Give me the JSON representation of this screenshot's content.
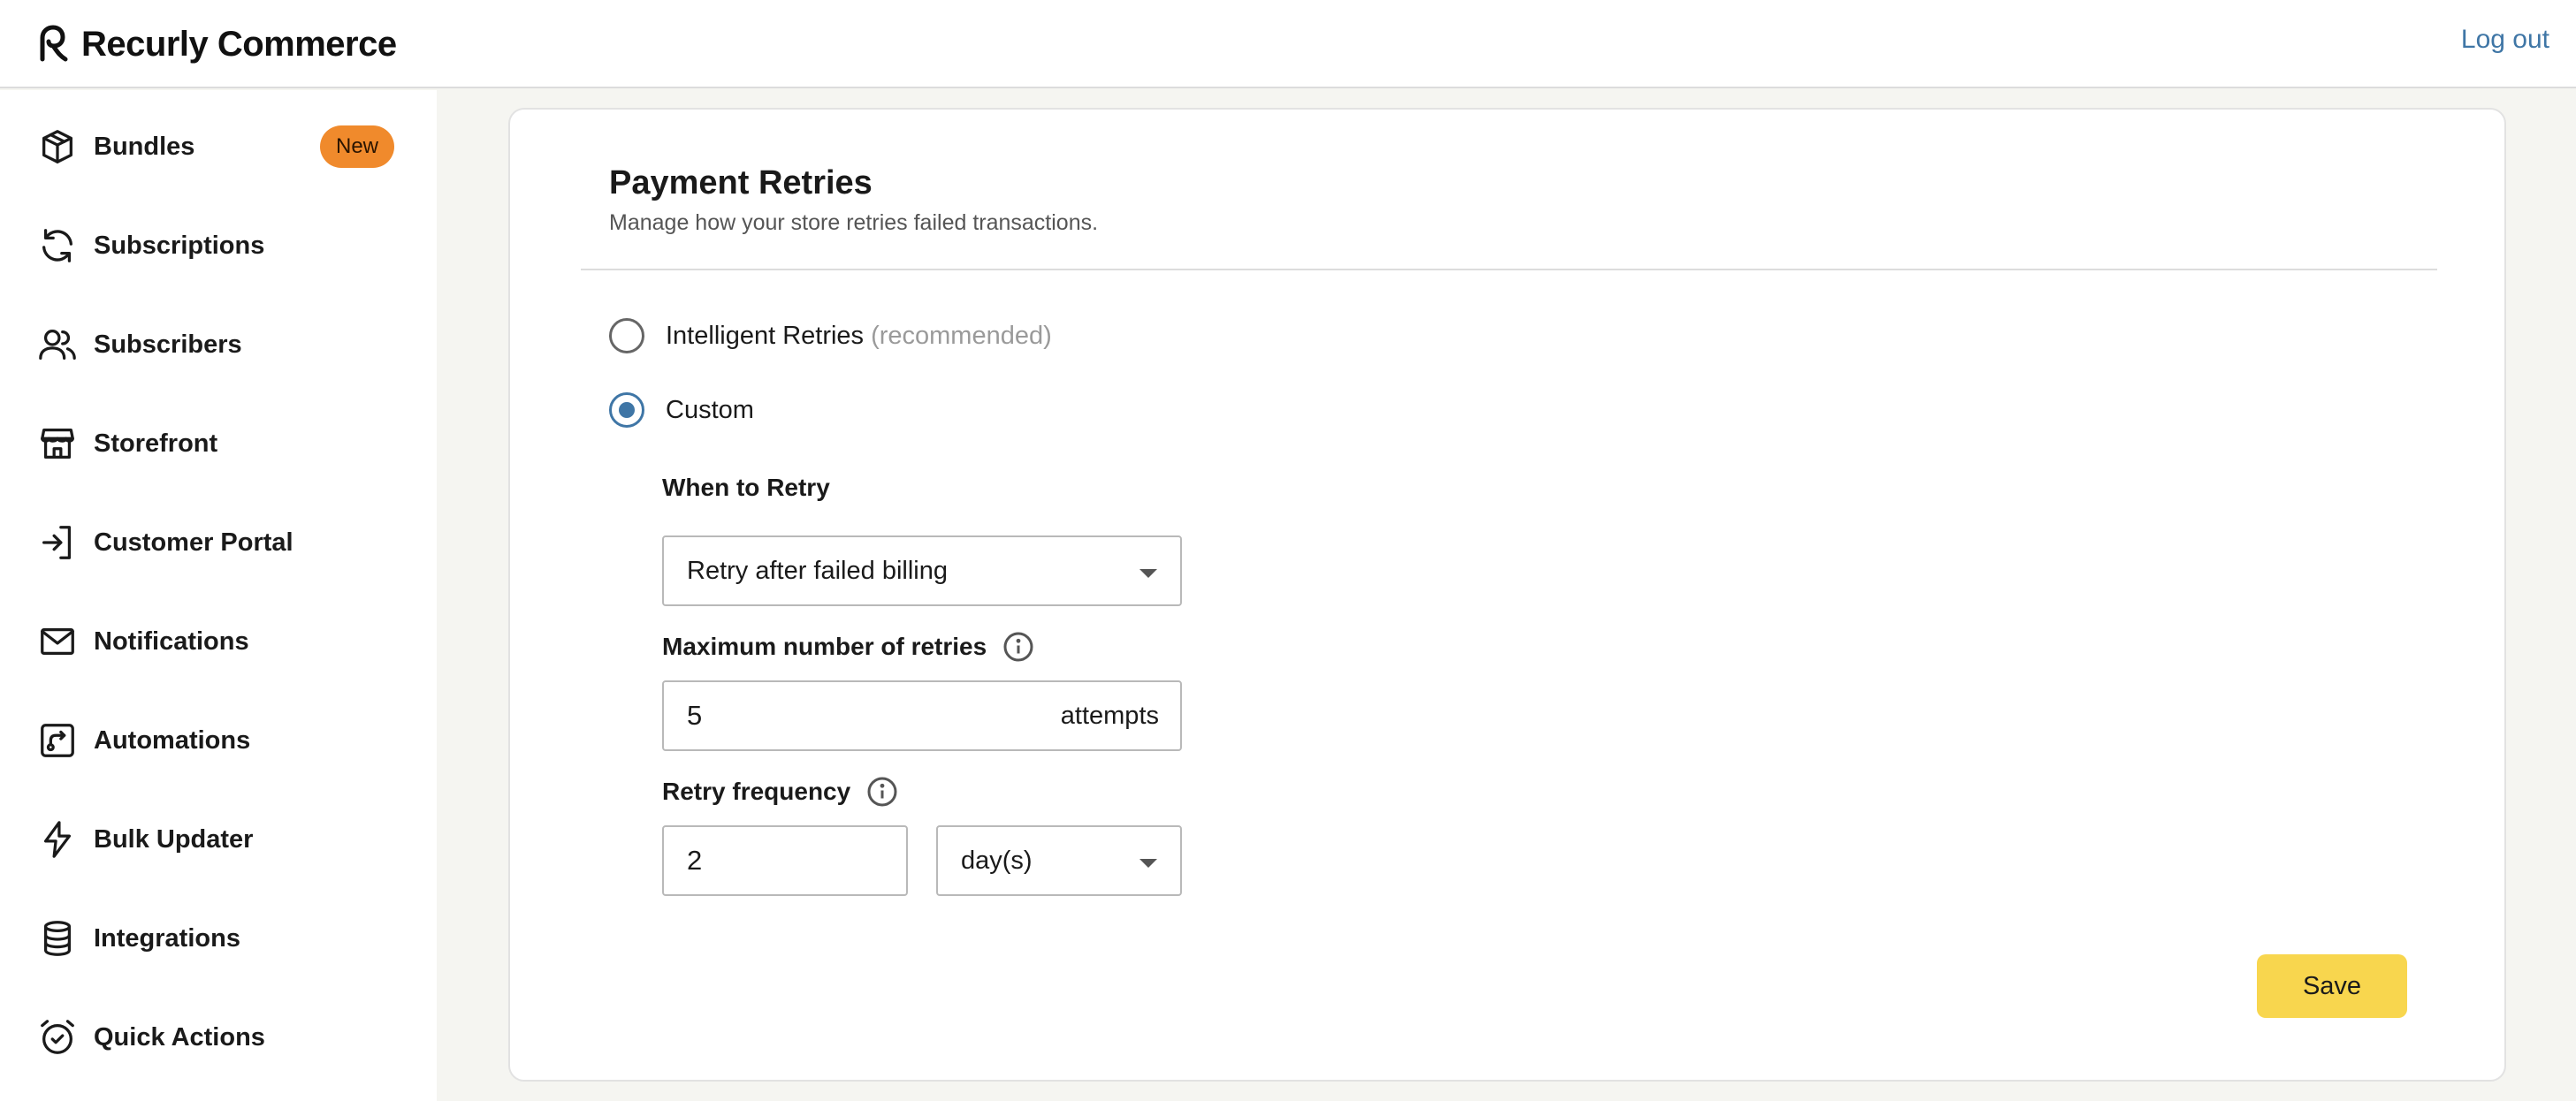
{
  "app": {
    "brand_name": "Recurly Commerce",
    "logout_label": "Log out"
  },
  "sidebar": {
    "items": [
      {
        "label": "Bundles",
        "icon": "box-icon",
        "badge": "New"
      },
      {
        "label": "Subscriptions",
        "icon": "refresh-icon"
      },
      {
        "label": "Subscribers",
        "icon": "users-icon"
      },
      {
        "label": "Storefront",
        "icon": "store-icon"
      },
      {
        "label": "Customer Portal",
        "icon": "login-icon"
      },
      {
        "label": "Notifications",
        "icon": "mail-icon"
      },
      {
        "label": "Automations",
        "icon": "route-icon"
      },
      {
        "label": "Bulk Updater",
        "icon": "bolt-icon"
      },
      {
        "label": "Integrations",
        "icon": "database-icon"
      },
      {
        "label": "Quick Actions",
        "icon": "alarm-clock-icon"
      }
    ]
  },
  "main": {
    "title": "Payment Retries",
    "subtitle": "Manage how your store retries failed transactions.",
    "options": [
      {
        "label": "Intelligent Retries",
        "hint": "(recommended)",
        "selected": false
      },
      {
        "label": "Custom",
        "selected": true
      }
    ],
    "when_to_retry": {
      "label": "When to Retry",
      "value": "Retry after failed billing"
    },
    "max_retries": {
      "label": "Maximum number of retries",
      "value": "5",
      "suffix": "attempts"
    },
    "retry_frequency": {
      "label": "Retry frequency",
      "value": "2",
      "unit": "day(s)"
    },
    "save_label": "Save"
  },
  "colors": {
    "accent": "#3f76a6",
    "badge": "#f08a2c",
    "save": "#f8d64e",
    "background": "#f5f5f1"
  }
}
